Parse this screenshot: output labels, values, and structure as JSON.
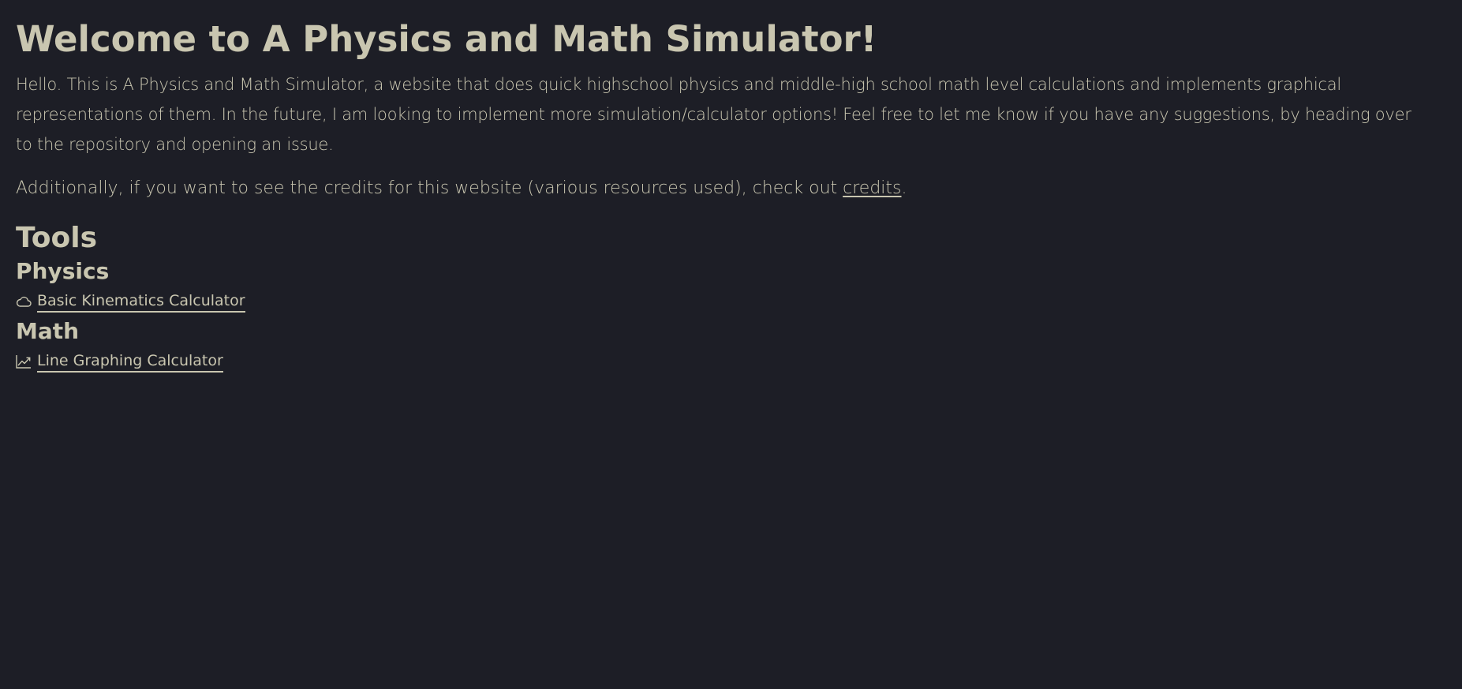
{
  "page": {
    "title": "Welcome to A Physics and Math Simulator!",
    "intro": "Hello. This is A Physics and Math Simulator, a website that does quick highschool physics and middle-high school math level calculations and implements graphical representations of them. In the future, I am looking to implement more simulation/calculator options! Feel free to let me know if you have any suggestions, by heading over to the repository and opening an issue.",
    "credits_prefix": "Additionally, if you want to see the credits for this website (various resources used), check out ",
    "credits_link": "credits",
    "credits_suffix": "."
  },
  "tools": {
    "heading": "Tools",
    "physics": {
      "heading": "Physics",
      "items": [
        {
          "label": "Basic Kinematics Calculator",
          "icon": "cloud-icon"
        }
      ]
    },
    "math": {
      "heading": "Math",
      "items": [
        {
          "label": "Line Graphing Calculator",
          "icon": "trending-up-icon"
        }
      ]
    }
  },
  "colors": {
    "background": "#1d1e26",
    "text": "#c9c6b0"
  }
}
